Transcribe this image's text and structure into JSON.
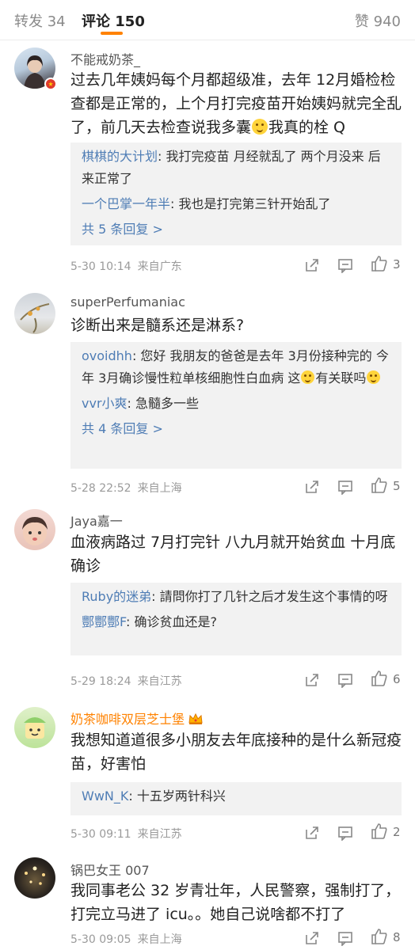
{
  "tabs": {
    "forward": "转发 34",
    "comment_label": "评论",
    "comment_count": "150",
    "like": "赞 940"
  },
  "comments": [
    {
      "user": "不能戒奶茶_",
      "text_a": "过去几年姨妈每个月都超级准，去年 12月婚检检查都是正常的，上个月打完疫苗开始姨妈就完全乱了，前几天去检查说我多囊",
      "text_b": "我真的栓 Q",
      "replies": [
        {
          "name": "棋棋的大计划",
          "text": ": 我打完疫苗 月经就乱了 两个月没来 后来正常了"
        },
        {
          "name": "一个巴掌一年半",
          "text": ": 我也是打完第三针开始乱了"
        }
      ],
      "more": "共 5 条回复 >",
      "time": "5-30 10:14",
      "location": "来自广东",
      "likes": "3"
    },
    {
      "user": "superPerfumaniac",
      "text": "诊断出来是髓系还是淋系?",
      "replies": [
        {
          "name": "ovoidhh",
          "text_a": ": 您好 我朋友的爸爸是去年 3月份接种完的 今年 3月确诊慢性粒单核细胞性白血病 这",
          "text_b": "有关联吗"
        },
        {
          "name": "vvr小爽",
          "text": ": 急髓多一些"
        }
      ],
      "more": "共 4 条回复 >",
      "time": "5-28 22:52",
      "location": "来自上海",
      "likes": "5"
    },
    {
      "user": "Jaya嘉一",
      "text": "血液病路过 7月打完针 八九月就开始贫血 十月底确诊",
      "replies": [
        {
          "name": "Ruby的迷弟",
          "text": ": 請問你打了几针之后才发生这个事情的呀"
        },
        {
          "name": "酆酆酆F",
          "text": ": 确诊贫血还是?"
        }
      ],
      "time": "5-29 18:24",
      "location": "来自江苏",
      "likes": "6"
    },
    {
      "user": "奶茶咖啡双层芝士堡",
      "text": "我想知道道很多小朋友去年底接种的是什么新冠疫苗，好害怕",
      "replies": [
        {
          "name": "WwN_K",
          "text": ": 十五岁两针科兴"
        }
      ],
      "time": "5-30 09:11",
      "location": "来自江苏",
      "likes": "2"
    },
    {
      "user": "锅巴女王 007",
      "text": "我同事老公 32 岁青壮年，人民警察，强制打了，打完立马进了 icu。。她自己说啥都不打了",
      "time": "5-30 09:05",
      "location": "来自上海",
      "likes": "8"
    }
  ],
  "icons": [
    "share-icon",
    "comment-icon",
    "like-icon",
    "crown-icon",
    "smiley-emoji"
  ],
  "colors": {
    "accent": "#ff8200",
    "link": "#4f7db5",
    "muted": "#9a9a9a",
    "reply_bg": "#f2f2f2"
  }
}
